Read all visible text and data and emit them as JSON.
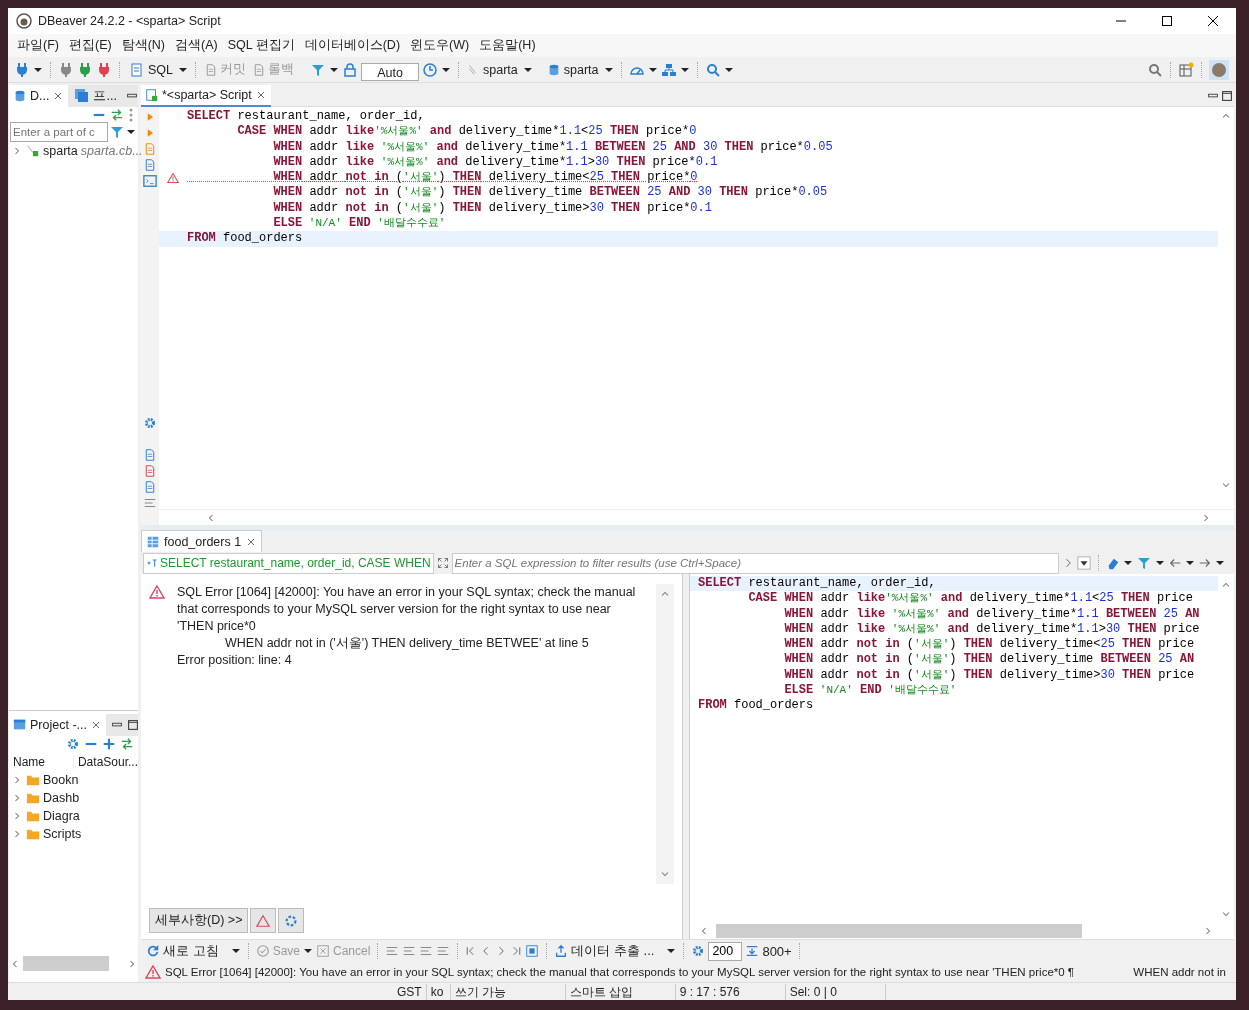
{
  "window": {
    "title": "DBeaver 24.2.2 - <sparta> Script"
  },
  "menu": [
    "파일(F)",
    "편집(E)",
    "탐색(N)",
    "검색(A)",
    "SQL 편집기",
    "데이터베이스(D)",
    "윈도우(W)",
    "도움말(H)"
  ],
  "toolbar": {
    "sql": "SQL",
    "commit": {
      "label": "커밋",
      "disabled": true
    },
    "rollback": {
      "label": "롤백",
      "disabled": true
    },
    "transaction_mode": "Auto",
    "datasource": "sparta",
    "schema": "sparta"
  },
  "navigator": {
    "tabs": [
      {
        "label": "D...",
        "selected": true
      },
      {
        "label": "프...",
        "selected": false
      }
    ],
    "filter": {
      "placeholder": "Enter a part of c"
    },
    "tree": [
      {
        "name": "sparta",
        "detail": "sparta.cb...",
        "expanded": false
      }
    ]
  },
  "project": {
    "tabs": [
      {
        "label": "Project -...",
        "selected": true
      }
    ],
    "columns": [
      "Name",
      "DataSour..."
    ],
    "tree": [
      {
        "name": "Bookn",
        "expanded": false
      },
      {
        "name": "Dashb",
        "expanded": false
      },
      {
        "name": "Diagra",
        "expanded": false
      },
      {
        "name": "Scripts",
        "expanded": false
      }
    ]
  },
  "editor": {
    "tabs": [
      {
        "label": "*<sparta> Script",
        "selected": true
      }
    ],
    "lines": [
      {
        "error": false,
        "current": false,
        "tokens": [
          {
            "kind": "kw",
            "text": "SELECT"
          },
          {
            "kind": "id",
            "text": " restaurant_name, order_id,"
          }
        ]
      },
      {
        "error": false,
        "current": false,
        "tokens": [
          {
            "kind": "kw",
            "text": "       CASE WHEN"
          },
          {
            "kind": "id",
            "text": " addr "
          },
          {
            "kind": "kw",
            "text": "like"
          },
          {
            "kind": "str",
            "text": "'%서울%'"
          },
          {
            "kind": "kw",
            "text": " and"
          },
          {
            "kind": "id",
            "text": " delivery_time*"
          },
          {
            "kind": "num",
            "text": "1.1"
          },
          {
            "kind": "id",
            "text": "<"
          },
          {
            "kind": "num",
            "text": "25"
          },
          {
            "kind": "kw",
            "text": " THEN"
          },
          {
            "kind": "id",
            "text": " price*"
          },
          {
            "kind": "num",
            "text": "0"
          }
        ]
      },
      {
        "error": false,
        "current": false,
        "tokens": [
          {
            "kind": "kw",
            "text": "            WHEN"
          },
          {
            "kind": "id",
            "text": " addr "
          },
          {
            "kind": "kw",
            "text": "like"
          },
          {
            "kind": "str",
            "text": " '%서울%'"
          },
          {
            "kind": "kw",
            "text": " and"
          },
          {
            "kind": "id",
            "text": " delivery_time*"
          },
          {
            "kind": "num",
            "text": "1.1"
          },
          {
            "kind": "kw",
            "text": " BETWEEN"
          },
          {
            "kind": "num",
            "text": " 25"
          },
          {
            "kind": "kw",
            "text": " AND"
          },
          {
            "kind": "num",
            "text": " 30"
          },
          {
            "kind": "kw",
            "text": " THEN"
          },
          {
            "kind": "id",
            "text": " price*"
          },
          {
            "kind": "num",
            "text": "0.05"
          }
        ]
      },
      {
        "error": false,
        "current": false,
        "tokens": [
          {
            "kind": "kw",
            "text": "            WHEN"
          },
          {
            "kind": "id",
            "text": " addr "
          },
          {
            "kind": "kw",
            "text": "like"
          },
          {
            "kind": "str",
            "text": " '%서울%'"
          },
          {
            "kind": "kw",
            "text": " and"
          },
          {
            "kind": "id",
            "text": " delivery_time*"
          },
          {
            "kind": "num",
            "text": "1.1"
          },
          {
            "kind": "id",
            "text": ">"
          },
          {
            "kind": "num",
            "text": "30"
          },
          {
            "kind": "kw",
            "text": " THEN"
          },
          {
            "kind": "id",
            "text": " price*"
          },
          {
            "kind": "num",
            "text": "0.1"
          }
        ]
      },
      {
        "error": true,
        "current": false,
        "tokens": [
          {
            "kind": "kw",
            "text": "            WHEN"
          },
          {
            "kind": "id",
            "text": " addr "
          },
          {
            "kind": "kw",
            "text": "not in"
          },
          {
            "kind": "id",
            "text": " ("
          },
          {
            "kind": "str",
            "text": "'서울'"
          },
          {
            "kind": "id",
            "text": ") "
          },
          {
            "kind": "kw",
            "text": "THEN"
          },
          {
            "kind": "id",
            "text": " delivery_time<"
          },
          {
            "kind": "num",
            "text": "25"
          },
          {
            "kind": "kw",
            "text": " THEN"
          },
          {
            "kind": "id",
            "text": " price*"
          },
          {
            "kind": "num",
            "text": "0"
          }
        ]
      },
      {
        "error": false,
        "current": false,
        "tokens": [
          {
            "kind": "kw",
            "text": "            WHEN"
          },
          {
            "kind": "id",
            "text": " addr "
          },
          {
            "kind": "kw",
            "text": "not in"
          },
          {
            "kind": "id",
            "text": " ("
          },
          {
            "kind": "str",
            "text": "'서울'"
          },
          {
            "kind": "id",
            "text": ") "
          },
          {
            "kind": "kw",
            "text": "THEN"
          },
          {
            "kind": "id",
            "text": " delivery_time "
          },
          {
            "kind": "kw",
            "text": "BETWEEN"
          },
          {
            "kind": "num",
            "text": " 25"
          },
          {
            "kind": "kw",
            "text": " AND"
          },
          {
            "kind": "num",
            "text": " 30"
          },
          {
            "kind": "kw",
            "text": " THEN"
          },
          {
            "kind": "id",
            "text": " price*"
          },
          {
            "kind": "num",
            "text": "0.05"
          }
        ]
      },
      {
        "error": false,
        "current": false,
        "tokens": [
          {
            "kind": "kw",
            "text": "            WHEN"
          },
          {
            "kind": "id",
            "text": " addr "
          },
          {
            "kind": "kw",
            "text": "not in"
          },
          {
            "kind": "id",
            "text": " ("
          },
          {
            "kind": "str",
            "text": "'서울'"
          },
          {
            "kind": "id",
            "text": ") "
          },
          {
            "kind": "kw",
            "text": "THEN"
          },
          {
            "kind": "id",
            "text": " delivery_time>"
          },
          {
            "kind": "num",
            "text": "30"
          },
          {
            "kind": "kw",
            "text": " THEN"
          },
          {
            "kind": "id",
            "text": " price*"
          },
          {
            "kind": "num",
            "text": "0.1"
          }
        ]
      },
      {
        "error": false,
        "current": false,
        "tokens": [
          {
            "kind": "kw",
            "text": "            ELSE"
          },
          {
            "kind": "str",
            "text": " 'N/A'"
          },
          {
            "kind": "kw",
            "text": " END"
          },
          {
            "kind": "str",
            "text": " '배달수수료'"
          }
        ]
      },
      {
        "error": false,
        "current": true,
        "tokens": [
          {
            "kind": "kw",
            "text": "FROM"
          },
          {
            "kind": "id",
            "text": " food_orders"
          }
        ]
      }
    ]
  },
  "results": {
    "tabs": [
      {
        "label": "food_orders 1",
        "selected": true
      }
    ],
    "query": "SELECT restaurant_name, order_id, CASE WHEN",
    "filter": {
      "placeholder": "Enter a SQL expression to filter results (use Ctrl+Space)"
    },
    "error": {
      "message": "SQL Error [1064] [42000]: You have an error in your SQL syntax; check the manual that corresponds to your MySQL server version for the right syntax to use near 'THEN price*0",
      "detail": "WHEN addr not in ('서울') THEN delivery_time BETWEE' at line 5",
      "position": "Error position: line: 4"
    },
    "details_button": "세부사항(D) >>",
    "sql_lines": [
      {
        "current": true,
        "tokens": [
          {
            "kind": "kw",
            "text": "SELECT"
          },
          {
            "kind": "id",
            "text": " restaurant_name, order_id,"
          }
        ]
      },
      {
        "current": false,
        "tokens": [
          {
            "kind": "kw",
            "text": "       CASE WHEN"
          },
          {
            "kind": "id",
            "text": " addr "
          },
          {
            "kind": "kw",
            "text": "like"
          },
          {
            "kind": "str",
            "text": "'%서울%'"
          },
          {
            "kind": "kw",
            "text": " and"
          },
          {
            "kind": "id",
            "text": " delivery_time*"
          },
          {
            "kind": "num",
            "text": "1.1"
          },
          {
            "kind": "id",
            "text": "<"
          },
          {
            "kind": "num",
            "text": "25"
          },
          {
            "kind": "kw",
            "text": " THEN"
          },
          {
            "kind": "id",
            "text": " price"
          }
        ]
      },
      {
        "current": false,
        "tokens": [
          {
            "kind": "kw",
            "text": "            WHEN"
          },
          {
            "kind": "id",
            "text": " addr "
          },
          {
            "kind": "kw",
            "text": "like"
          },
          {
            "kind": "str",
            "text": " '%서울%'"
          },
          {
            "kind": "kw",
            "text": " and"
          },
          {
            "kind": "id",
            "text": " delivery_time*"
          },
          {
            "kind": "num",
            "text": "1.1"
          },
          {
            "kind": "kw",
            "text": " BETWEEN"
          },
          {
            "kind": "num",
            "text": " 25"
          },
          {
            "kind": "kw",
            "text": " AN"
          }
        ]
      },
      {
        "current": false,
        "tokens": [
          {
            "kind": "kw",
            "text": "            WHEN"
          },
          {
            "kind": "id",
            "text": " addr "
          },
          {
            "kind": "kw",
            "text": "like"
          },
          {
            "kind": "str",
            "text": " '%서울%'"
          },
          {
            "kind": "kw",
            "text": " and"
          },
          {
            "kind": "id",
            "text": " delivery_time*"
          },
          {
            "kind": "num",
            "text": "1.1"
          },
          {
            "kind": "id",
            "text": ">"
          },
          {
            "kind": "num",
            "text": "30"
          },
          {
            "kind": "kw",
            "text": " THEN"
          },
          {
            "kind": "id",
            "text": " price"
          }
        ]
      },
      {
        "current": false,
        "tokens": [
          {
            "kind": "kw",
            "text": "            WHEN"
          },
          {
            "kind": "id",
            "text": " addr "
          },
          {
            "kind": "kw",
            "text": "not in"
          },
          {
            "kind": "id",
            "text": " ("
          },
          {
            "kind": "str",
            "text": "'서울'"
          },
          {
            "kind": "id",
            "text": ") "
          },
          {
            "kind": "kw",
            "text": "THEN"
          },
          {
            "kind": "id",
            "text": " delivery_time<"
          },
          {
            "kind": "num",
            "text": "25"
          },
          {
            "kind": "kw",
            "text": " THEN"
          },
          {
            "kind": "id",
            "text": " price"
          }
        ]
      },
      {
        "current": false,
        "tokens": [
          {
            "kind": "kw",
            "text": "            WHEN"
          },
          {
            "kind": "id",
            "text": " addr "
          },
          {
            "kind": "kw",
            "text": "not in"
          },
          {
            "kind": "id",
            "text": " ("
          },
          {
            "kind": "str",
            "text": "'서울'"
          },
          {
            "kind": "id",
            "text": ") "
          },
          {
            "kind": "kw",
            "text": "THEN"
          },
          {
            "kind": "id",
            "text": " delivery_time "
          },
          {
            "kind": "kw",
            "text": "BETWEEN"
          },
          {
            "kind": "num",
            "text": " 25"
          },
          {
            "kind": "kw",
            "text": " AN"
          }
        ]
      },
      {
        "current": false,
        "tokens": [
          {
            "kind": "kw",
            "text": "            WHEN"
          },
          {
            "kind": "id",
            "text": " addr "
          },
          {
            "kind": "kw",
            "text": "not in"
          },
          {
            "kind": "id",
            "text": " ("
          },
          {
            "kind": "str",
            "text": "'서울'"
          },
          {
            "kind": "id",
            "text": ") "
          },
          {
            "kind": "kw",
            "text": "THEN"
          },
          {
            "kind": "id",
            "text": " delivery_time>"
          },
          {
            "kind": "num",
            "text": "30"
          },
          {
            "kind": "kw",
            "text": " THEN"
          },
          {
            "kind": "id",
            "text": " price"
          }
        ]
      },
      {
        "current": false,
        "tokens": [
          {
            "kind": "kw",
            "text": "            ELSE"
          },
          {
            "kind": "str",
            "text": " 'N/A'"
          },
          {
            "kind": "kw",
            "text": " END"
          },
          {
            "kind": "str",
            "text": " '배달수수료'"
          }
        ]
      },
      {
        "current": false,
        "tokens": [
          {
            "kind": "kw",
            "text": "FROM"
          },
          {
            "kind": "id",
            "text": " food_orders"
          }
        ]
      }
    ]
  },
  "bottom_toolbar": {
    "refresh": "새로 고침",
    "save": {
      "label": "Save",
      "disabled": true
    },
    "cancel": {
      "label": "Cancel",
      "disabled": true
    },
    "export": "데이터 추출 ...",
    "fetch_size": "200",
    "row_count": "800+"
  },
  "status_message": {
    "text": "SQL Error [1064] [42000]: You have an error in your SQL syntax; check the manual that corresponds to your MySQL server version for the right syntax to use near 'THEN price*0 ¶",
    "tail": "WHEN addr not in"
  },
  "status_bar": [
    "GST",
    "ko",
    "쓰기 가능",
    "스마트 삽입",
    "9 : 17 : 576",
    "Sel: 0 | 0"
  ]
}
